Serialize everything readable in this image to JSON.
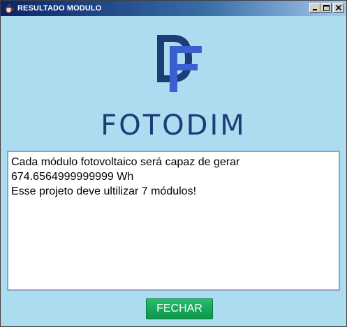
{
  "window": {
    "title": "RESULTADO MODULO",
    "icon": "java-cup-icon",
    "controls": {
      "minimize": "minimize-icon",
      "maximize": "maximize-icon",
      "close": "close-icon"
    }
  },
  "logo": {
    "icon": "df-logo-icon",
    "brand_name": "FOTODIM"
  },
  "result": {
    "text": "Cada módulo fotovoltaico será capaz de gerar\n674.6564999999999 Wh\nEsse projeto deve ultilizar 7 módulos!"
  },
  "actions": {
    "close_label": "FECHAR"
  },
  "colors": {
    "background": "#abdcf0",
    "brand": "#1e3c78",
    "button": "#17a85a"
  }
}
